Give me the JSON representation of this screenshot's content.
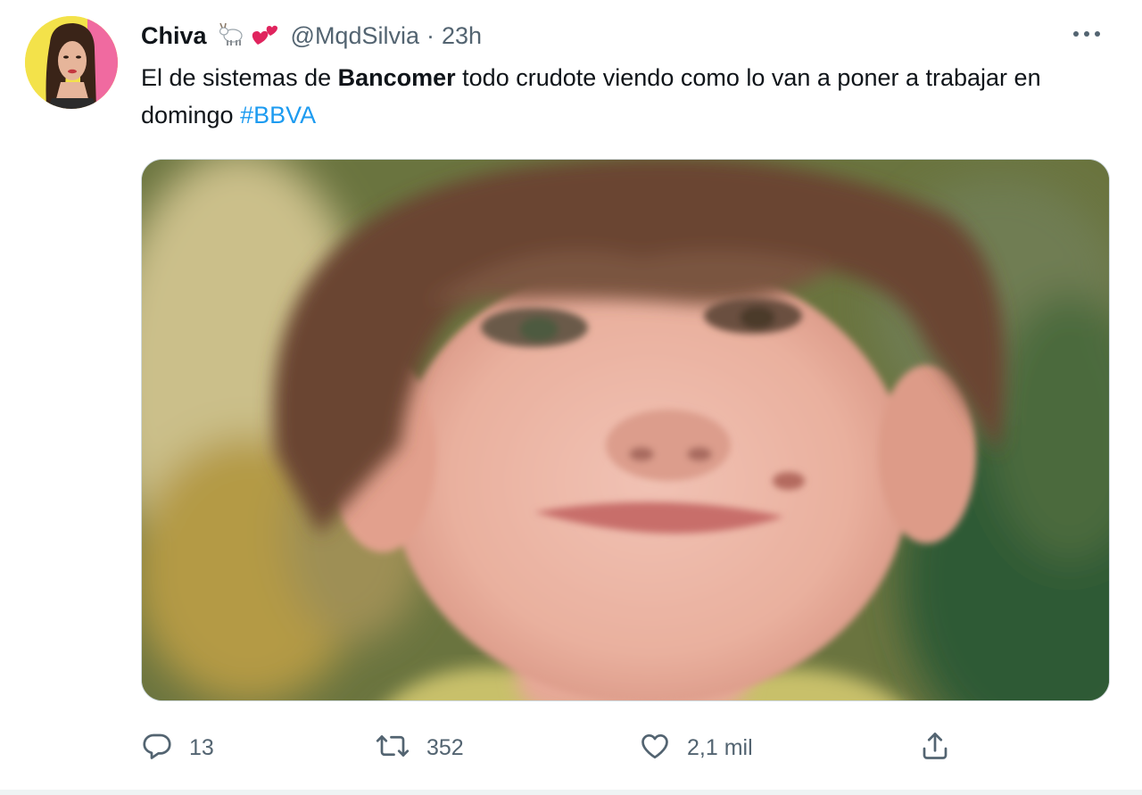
{
  "author": {
    "display_name": "Chiva",
    "emojis": [
      "goat-emoji",
      "two-hearts-emoji"
    ],
    "handle": "@MqdSilvia",
    "separator": "·",
    "time": "23h"
  },
  "tweet": {
    "text_part1": "El de sistemas de ",
    "text_bold": "Bancomer",
    "text_part2": " todo crudote viendo como lo van a poner a trabajar en domingo ",
    "hashtag": "#BBVA"
  },
  "actions": {
    "reply_count": "13",
    "retweet_count": "352",
    "like_count": "2,1 mil"
  },
  "icons": {
    "more": "more-horizontal-icon",
    "reply": "reply-icon",
    "retweet": "retweet-icon",
    "like": "heart-icon",
    "share": "share-icon"
  },
  "colors": {
    "link": "#1d9bf0",
    "secondary_text": "#536471",
    "primary_text": "#0f1419"
  }
}
